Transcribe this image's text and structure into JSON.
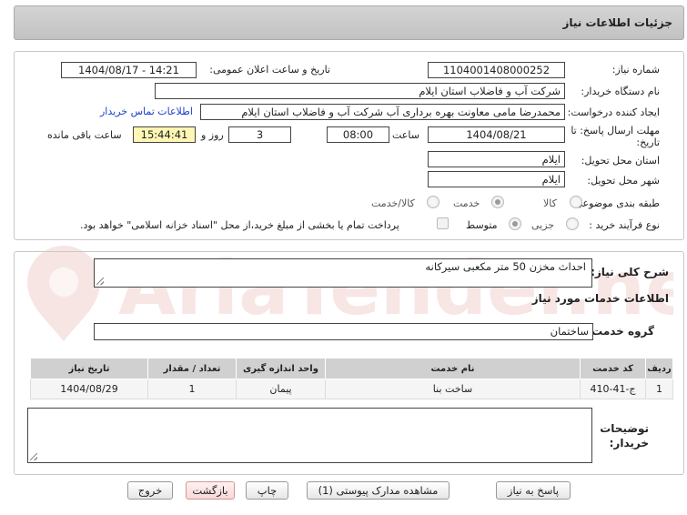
{
  "header": {
    "title": "جزئیات اطلاعات نیاز"
  },
  "form": {
    "need_number_label": "شماره نیاز:",
    "need_number": "1104001408000252",
    "announce_label": "تاریخ و ساعت اعلان عمومی:",
    "announce_value": "1404/08/17 - 14:21",
    "buyer_org_label": "نام دستگاه خریدار:",
    "buyer_org": "شرکت آب و فاضلاب استان ایلام",
    "creator_label": "ایجاد کننده درخواست:",
    "creator": "محمدرضا مامی معاونت بهره برداری آب  شرکت آب و فاضلاب استان ایلام",
    "contact_link": "اطلاعات تماس خریدار",
    "deadline_label_1": "مهلت ارسال پاسخ: تا",
    "deadline_label_2": "تاریخ:",
    "deadline_date": "1404/08/21",
    "time_label": "ساعت",
    "deadline_time": "08:00",
    "days_value": "3",
    "days_label": "روز و",
    "remaining_time": "15:44:41",
    "remaining_label": "ساعت باقی مانده",
    "province_label": "استان محل تحویل:",
    "province": "ایلام",
    "city_label": "شهر محل تحویل:",
    "city": "ایلام",
    "category_label": "طبقه بندی موضوعی:",
    "category_options": [
      "کالا",
      "خدمت",
      "کالا/خدمت"
    ],
    "category_selected": "خدمت",
    "process_label": "نوع فرآیند خرید :",
    "process_options": [
      "جزیی",
      "متوسط"
    ],
    "process_selected": "متوسط",
    "payment_note": "پرداخت تمام یا بخشی از مبلغ خرید،از محل \"اسناد خزانه اسلامی\" خواهد بود."
  },
  "details": {
    "summary_label": "شرح کلی نیاز:",
    "summary": "احداث مخزن 50 متر مکعبی سیرکانه",
    "services_title": "اطلاعات خدمات مورد نیاز",
    "service_group_label": "گروه خدمت:",
    "service_group": "ساختمان",
    "table": {
      "headers": [
        "ردیف",
        "کد خدمت",
        "نام خدمت",
        "واحد اندازه گیری",
        "تعداد / مقدار",
        "تاریخ نیاز"
      ],
      "rows": [
        [
          "1",
          "ج-41-410",
          "ساخت بنا",
          "پیمان",
          "1",
          "1404/08/29"
        ]
      ]
    },
    "buyer_notes_label_1": "توضیحات",
    "buyer_notes_label_2": "خریدار:",
    "buyer_notes": ""
  },
  "buttons": {
    "reply": "پاسخ به نیاز",
    "attachments": "مشاهده مدارک پیوستی (1)",
    "print": "چاپ",
    "back": "بازگشت",
    "exit": "خروج"
  },
  "watermark": {
    "text": "AriaTender.net"
  },
  "colors": {
    "link": "#1a3fcc",
    "remaining_bg": "#fff6b4",
    "header_bg": "#c8c8c8",
    "danger_btn": "#f8d8d8"
  }
}
